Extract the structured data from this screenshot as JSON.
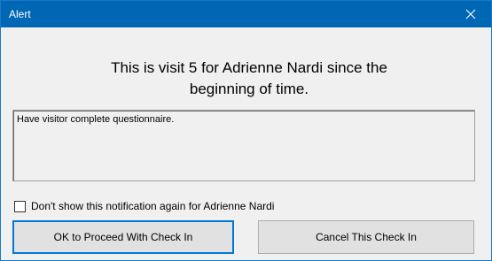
{
  "window": {
    "title": "Alert",
    "close_icon": "close-icon"
  },
  "message": {
    "line1": "This is visit 5 for Adrienne Nardi since the",
    "line2": "beginning of time."
  },
  "notes": {
    "text": "Have visitor complete questionnaire."
  },
  "options": {
    "dont_show_label": "Don't show this notification again for Adrienne Nardi",
    "dont_show_checked": false
  },
  "buttons": {
    "ok_label": "OK to Proceed With Check In",
    "cancel_label": "Cancel This Check In"
  },
  "colors": {
    "titlebar": "#0067b5",
    "focus_border": "#0078d7"
  }
}
